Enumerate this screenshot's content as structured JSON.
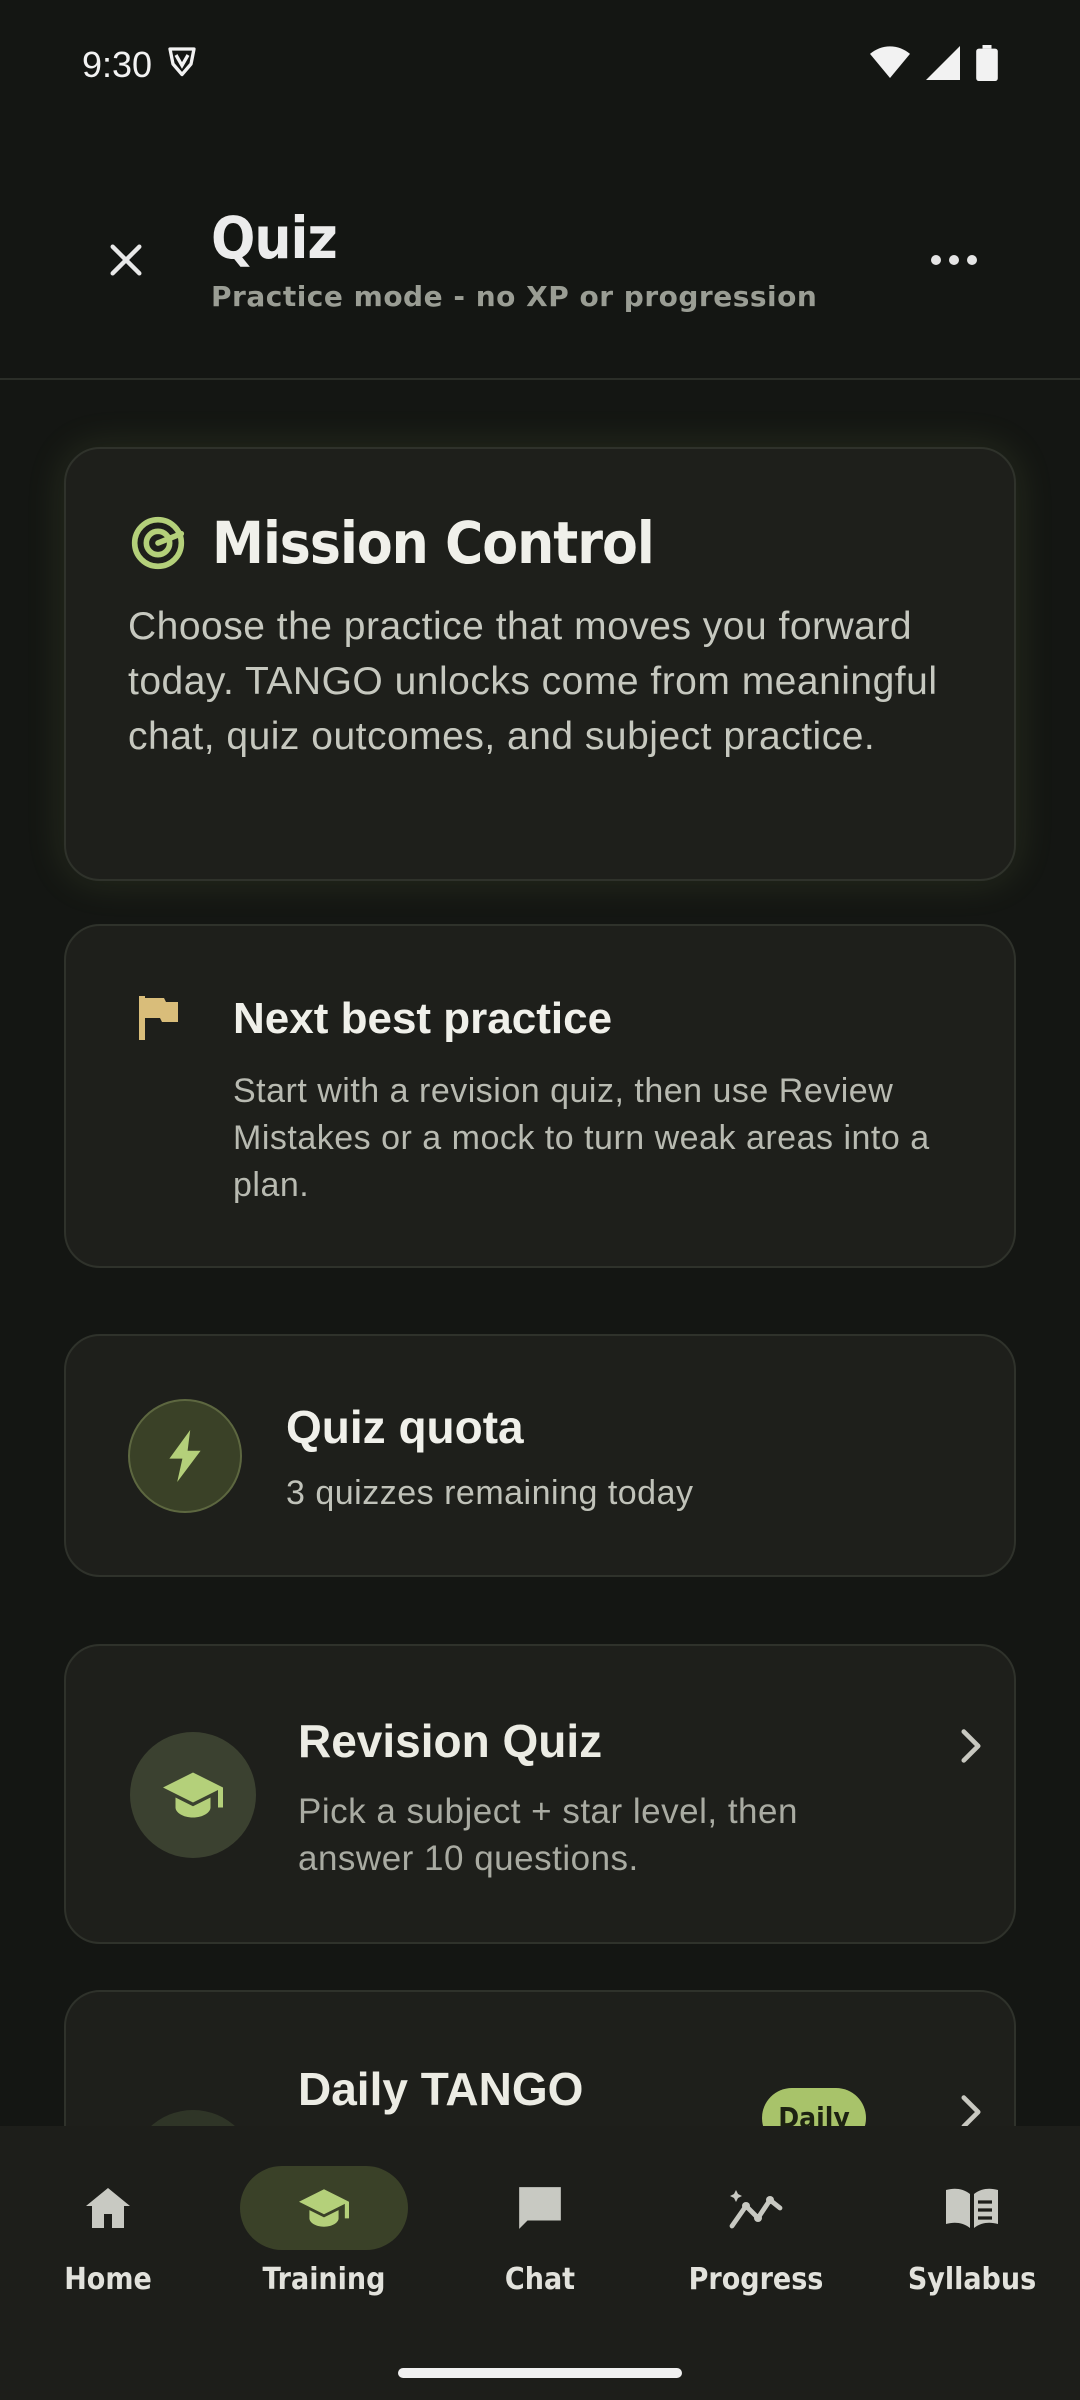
{
  "status": {
    "time": "9:30"
  },
  "header": {
    "title": "Quiz",
    "subtitle": "Practice mode - no XP or progression"
  },
  "mission": {
    "title": "Mission Control",
    "text": "Choose the practice that moves you forward today. TANGO unlocks come from meaningful chat, quiz outcomes, and subject practice."
  },
  "next_practice": {
    "title": "Next best practice",
    "text": "Start with a revision quiz, then use Review Mistakes or a mock to turn weak areas into a plan."
  },
  "quota": {
    "title": "Quiz quota",
    "text": "3 quizzes remaining today"
  },
  "revision": {
    "title": "Revision Quiz",
    "text": "Pick a subject + star level, then answer 10 questions."
  },
  "daily": {
    "title": "Daily TANGO",
    "badge": "Daily"
  },
  "nav": {
    "items": [
      {
        "label": "Home",
        "icon": "home-icon"
      },
      {
        "label": "Training",
        "icon": "graduation-cap-icon",
        "active": true
      },
      {
        "label": "Chat",
        "icon": "chat-icon"
      },
      {
        "label": "Progress",
        "icon": "progress-icon"
      },
      {
        "label": "Syllabus",
        "icon": "book-icon"
      }
    ]
  },
  "colors": {
    "background": "#141613",
    "card": "#1e1f1b",
    "accent": "#a8c36a",
    "flag": "#d9bd7a"
  }
}
